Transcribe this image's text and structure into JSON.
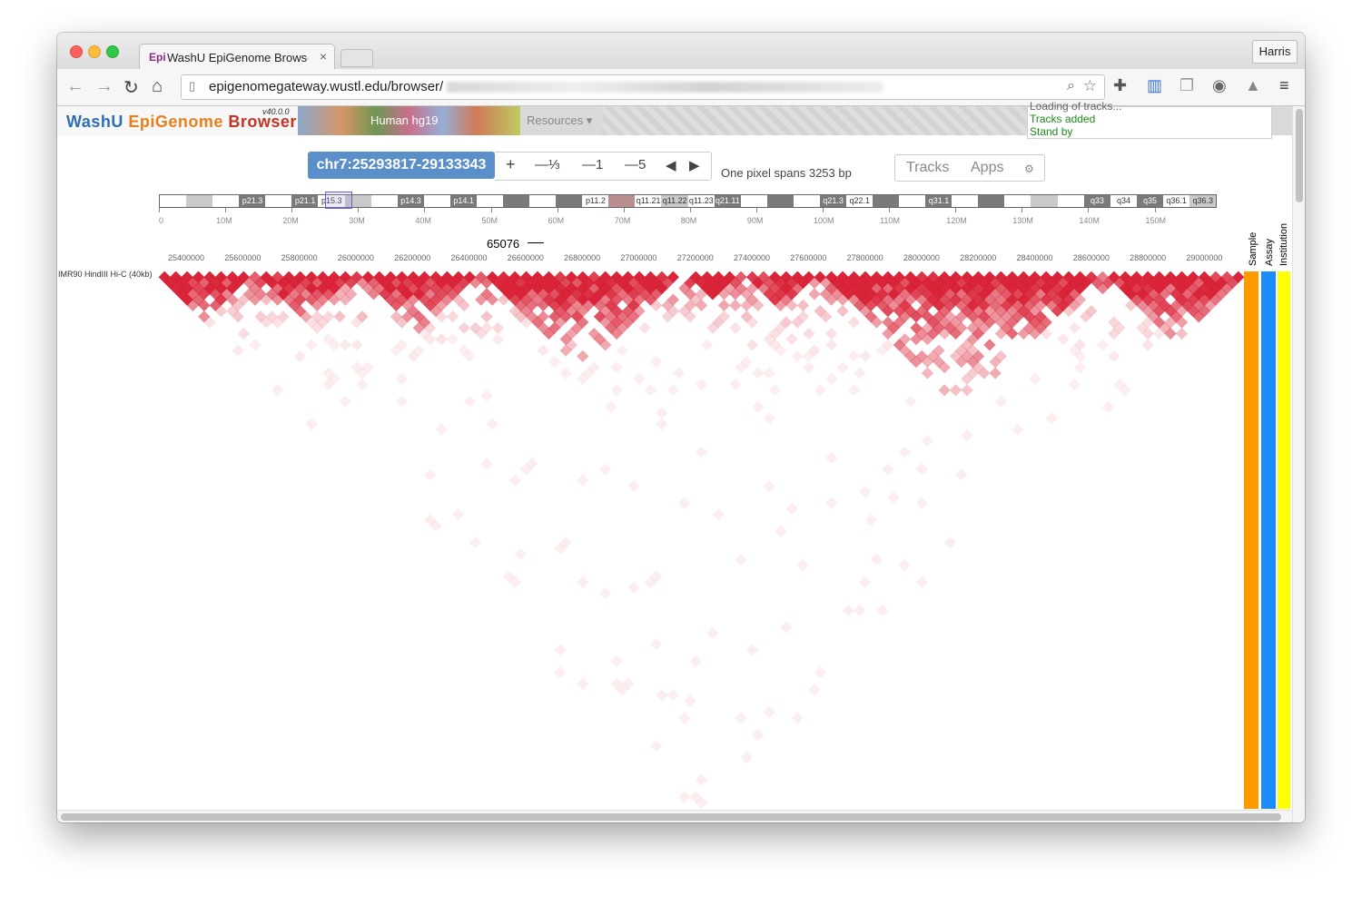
{
  "browser": {
    "tab_favicon": "Epi",
    "tab_title": "WashU EpiGenome Browser",
    "tab_close": "×",
    "profile_name": "Harris",
    "url": "epigenomegateway.wustl.edu/browser/",
    "icons": [
      "back-icon",
      "forward-icon",
      "reload-icon",
      "home-icon",
      "page-icon",
      "zoom-icon",
      "star-icon",
      "extension-icon",
      "bookmark-icon",
      "copy-icon",
      "globe-icon",
      "drive-icon",
      "menu-icon"
    ]
  },
  "app": {
    "brand": {
      "part1": "WashU ",
      "part2": "EpiGenome ",
      "part3": "Browser",
      "version": "v40.0.0"
    },
    "genome": "Human hg19",
    "resources_menu": "Resources ▾",
    "status_lines": [
      "Loading of tracks...",
      "Tracks added",
      "Stand by"
    ],
    "colors": {
      "brand_blue": "#2e6eb4",
      "brand_orange": "#e8801b",
      "brand_red": "#c43424",
      "coord_button": "#5a8fca",
      "status_green": "#1a8a1a",
      "hic_red": "#d7192e",
      "sample": "#ff9900",
      "assay": "#1a8cff",
      "institution": "#ffff00"
    }
  },
  "controls": {
    "coordinate": "chr7:25293817-29133343",
    "zoom_in": "+",
    "zoom_third": "—⅓",
    "zoom_1": "—1",
    "zoom_5": "—5",
    "pan_left": "◀",
    "pan_right": "▶",
    "pixel_span": "One pixel spans 3253 bp",
    "tracks": "Tracks",
    "apps": "Apps",
    "settings_icon": "⚙"
  },
  "ideogram": {
    "bands": [
      {
        "label": "",
        "type": "w"
      },
      {
        "label": "",
        "type": "l"
      },
      {
        "label": "",
        "type": "w"
      },
      {
        "label": "p21.3",
        "type": "g"
      },
      {
        "label": "",
        "type": "w"
      },
      {
        "label": "p21.1",
        "type": "g"
      },
      {
        "label": "p15.3",
        "type": "w"
      },
      {
        "label": "",
        "type": "l"
      },
      {
        "label": "",
        "type": "w"
      },
      {
        "label": "p14.3",
        "type": "g"
      },
      {
        "label": "",
        "type": "w"
      },
      {
        "label": "p14.1",
        "type": "g"
      },
      {
        "label": "",
        "type": "w"
      },
      {
        "label": "",
        "type": "g"
      },
      {
        "label": "",
        "type": "w"
      },
      {
        "label": "",
        "type": "g"
      },
      {
        "label": "p11.2",
        "type": "w"
      },
      {
        "label": "",
        "type": "c"
      },
      {
        "label": "q11.21",
        "type": "w"
      },
      {
        "label": "q11.22",
        "type": "l"
      },
      {
        "label": "q11.23",
        "type": "w"
      },
      {
        "label": "q21.11",
        "type": "g"
      },
      {
        "label": "",
        "type": "w"
      },
      {
        "label": "",
        "type": "g"
      },
      {
        "label": "",
        "type": "w"
      },
      {
        "label": "q21.3",
        "type": "g"
      },
      {
        "label": "q22.1",
        "type": "w"
      },
      {
        "label": "",
        "type": "g"
      },
      {
        "label": "",
        "type": "w"
      },
      {
        "label": "q31.1",
        "type": "g"
      },
      {
        "label": "",
        "type": "w"
      },
      {
        "label": "",
        "type": "g"
      },
      {
        "label": "",
        "type": "w"
      },
      {
        "label": "",
        "type": "l"
      },
      {
        "label": "",
        "type": "w"
      },
      {
        "label": "q33",
        "type": "g"
      },
      {
        "label": "q34",
        "type": "w"
      },
      {
        "label": "q35",
        "type": "g"
      },
      {
        "label": "q36.1",
        "type": "w"
      },
      {
        "label": "q36.3",
        "type": "l"
      }
    ],
    "ruler": [
      "0",
      "10M",
      "20M",
      "30M",
      "40M",
      "50M",
      "60M",
      "70M",
      "80M",
      "90M",
      "100M",
      "110M",
      "120M",
      "130M",
      "140M",
      "150M"
    ]
  },
  "track": {
    "scale_label": "65076",
    "coordinates": [
      "25400000",
      "25600000",
      "25800000",
      "26000000",
      "26200000",
      "26400000",
      "26600000",
      "26800000",
      "27000000",
      "27200000",
      "27400000",
      "27600000",
      "27800000",
      "28000000",
      "28200000",
      "28400000",
      "28600000",
      "28800000",
      "29000000"
    ],
    "name": "IMR90 HindIII Hi-C (40kb)",
    "metadata_labels": [
      "Sample",
      "Assay",
      "Institution"
    ]
  },
  "heatmap": {
    "domains": [
      {
        "start": 0.0,
        "end": 0.09,
        "strength": 0.65
      },
      {
        "start": 0.09,
        "end": 0.18,
        "strength": 0.6
      },
      {
        "start": 0.18,
        "end": 0.3,
        "strength": 0.65
      },
      {
        "start": 0.3,
        "end": 0.48,
        "strength": 0.75
      },
      {
        "start": 0.48,
        "end": 0.54,
        "strength": 0.75
      },
      {
        "start": 0.54,
        "end": 0.61,
        "strength": 0.55
      },
      {
        "start": 0.61,
        "end": 0.87,
        "strength": 0.8
      },
      {
        "start": 0.87,
        "end": 1.0,
        "strength": 0.65
      }
    ]
  }
}
